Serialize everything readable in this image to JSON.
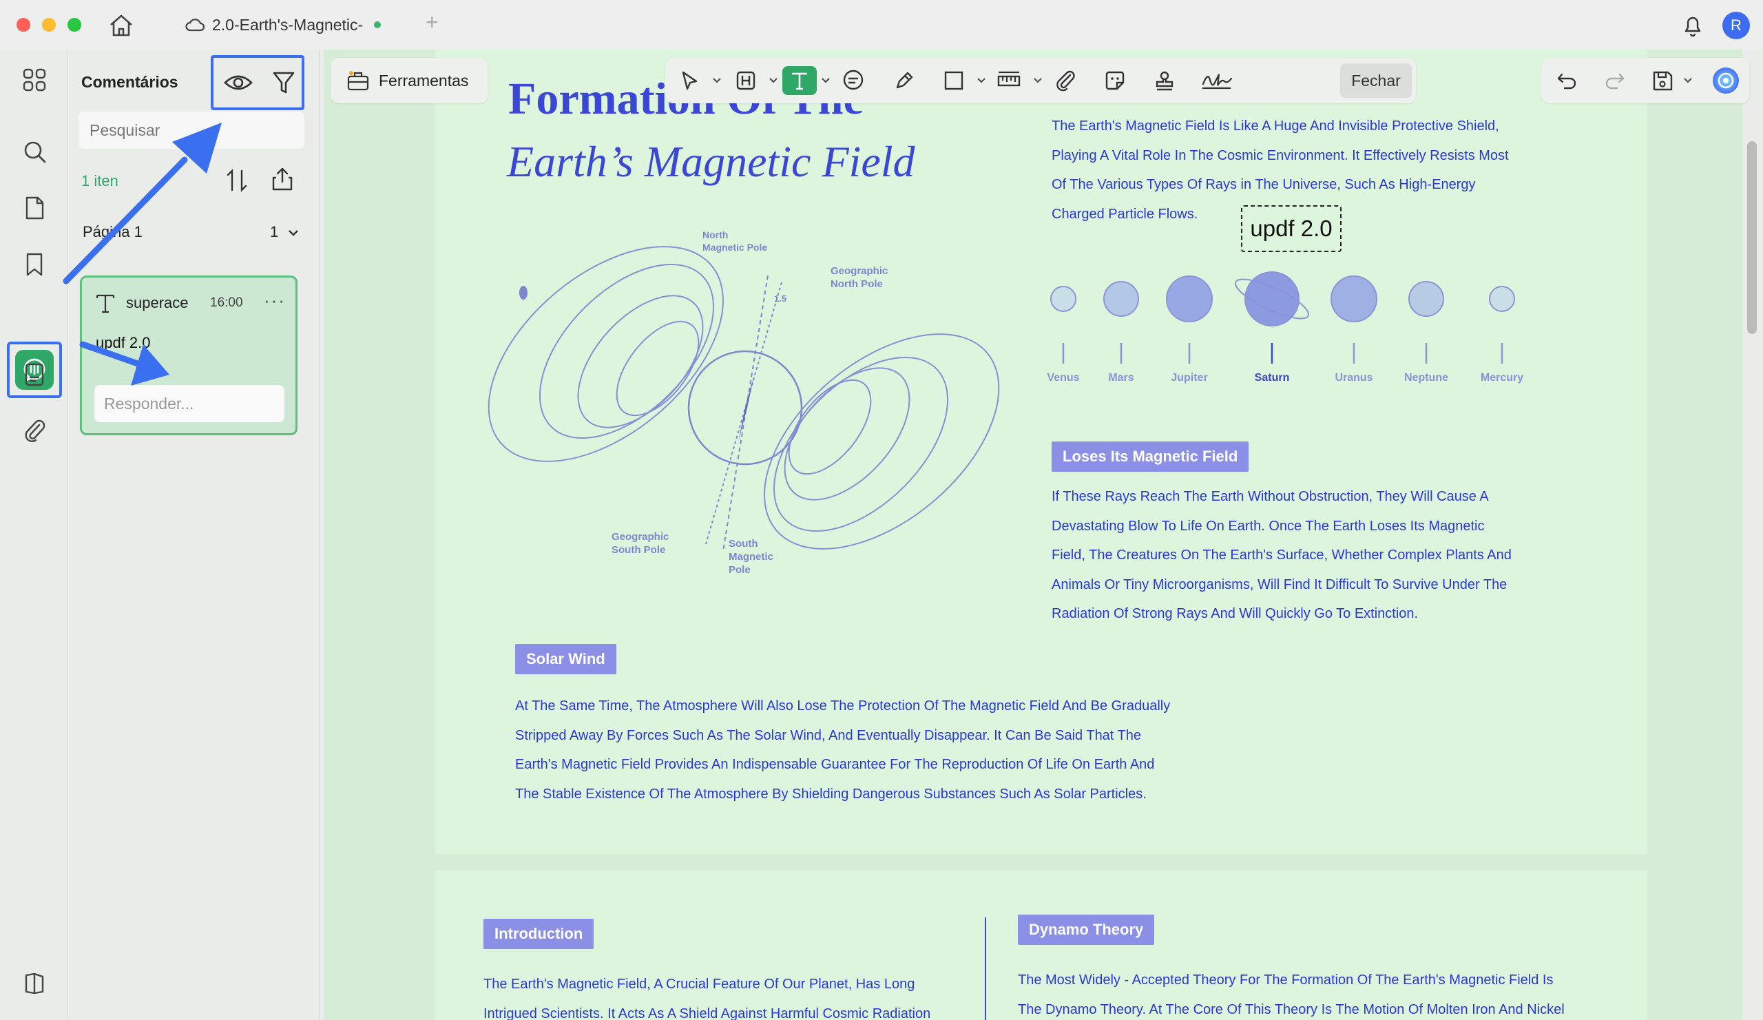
{
  "window": {
    "tab_title": "2.0-Earth's-Magnetic-",
    "user_initial": "R"
  },
  "panel": {
    "title": "Comentários",
    "search_placeholder": "Pesquisar",
    "count": "1 iten",
    "page_label": "Página 1",
    "page_count": "1",
    "comment": {
      "author": "superace",
      "time": "16:00",
      "text": "updf 2.0",
      "reply_placeholder": "Responder..."
    }
  },
  "toolbar": {
    "tools_label": "Ferramentas",
    "close_label": "Fechar"
  },
  "document": {
    "title_line1": "Formation Of The",
    "title_line2": "Earth’s Magnetic Field",
    "intro_lines": [
      "The Earth's Magnetic Field Is Like A Huge And Invisible Protective Shield,",
      "Playing A Vital Role In The Cosmic Environment. It Effectively Resists Most",
      "Of The Various Types Of Rays in The Universe, Such As High-Energy",
      "Charged Particle Flows."
    ],
    "annotation_text": "updf 2.0",
    "diagram_labels": {
      "north_magnetic": [
        "North",
        "Magnetic Pole"
      ],
      "geo_north": [
        "Geographic",
        "North Pole"
      ],
      "geo_south": [
        "Geographic",
        "South Pole"
      ],
      "south_magnetic": [
        "South",
        "Magnetic",
        "Pole"
      ],
      "angle": "1.5"
    },
    "planets": [
      "Venus",
      "Mars",
      "Jupiter",
      "Saturn",
      "Uranus",
      "Neptune",
      "Mercury"
    ],
    "section_loses": {
      "heading": "Loses Its Magnetic Field",
      "lines": [
        "If These Rays Reach The Earth Without Obstruction, They Will Cause A",
        "Devastating Blow To Life On Earth. Once The Earth Loses Its Magnetic",
        "Field, The Creatures On The Earth's Surface, Whether Complex Plants And",
        "Animals Or Tiny Microorganisms, Will Find It Difficult To Survive Under The",
        "Radiation Of Strong Rays And Will Quickly Go To Extinction."
      ]
    },
    "section_solar": {
      "heading": "Solar Wind",
      "lines": [
        "At The Same Time, The Atmosphere Will Also Lose The Protection Of The Magnetic Field And Be Gradually",
        "Stripped Away By Forces Such As The Solar Wind, And Eventually Disappear. It Can Be Said That The",
        "Earth's Magnetic Field Provides An Indispensable Guarantee For The Reproduction Of Life On Earth And",
        "The Stable Existence Of The Atmosphere By Shielding Dangerous Substances Such As Solar Particles."
      ]
    },
    "section_intro": {
      "heading": "Introduction",
      "lines": [
        "The Earth's Magnetic Field, A Crucial Feature Of Our Planet, Has Long",
        "Intrigued Scientists. It Acts As A Shield Against Harmful Cosmic Radiation"
      ]
    },
    "section_dynamo": {
      "heading": "Dynamo Theory",
      "lines": [
        "The Most Widely - Accepted Theory For The Formation Of The Earth's Magnetic Field Is",
        "The Dynamo Theory. At The Core Of This Theory Is The Motion Of Molten Iron And Nickel"
      ]
    }
  },
  "colors": {
    "accent_green": "#2fa767",
    "highlight_blue": "#3a6ff0",
    "doc_text_blue": "#2b38d0",
    "page_bg": "#ddf5dd"
  }
}
